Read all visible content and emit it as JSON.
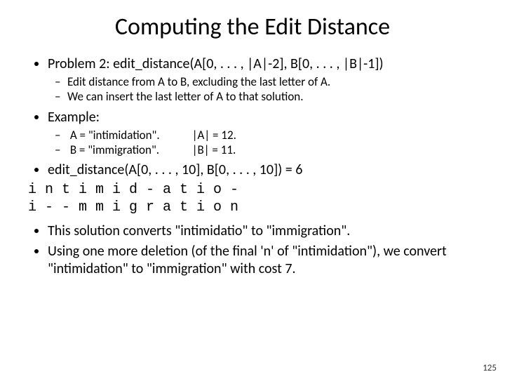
{
  "title": "Computing the Edit Distance",
  "b1": "Problem 2: edit_distance(A[0, . . . , |A|-2], B[0, . . . , |B|-1])",
  "b1s1": "Edit distance from A to B, excluding the last letter of A.",
  "b1s2": "We can insert the last letter of A to that solution.",
  "b2": "Example:",
  "b2s1a": "A = \"intimidation\".",
  "b2s1b": "|A| = 12.",
  "b2s2a": "B = \"immigration\".",
  "b2s2b": "|B| = 11.",
  "b3": "edit_distance(A[0, . . . , 10], B[0, . . . , 10]) = 6",
  "row1": "i n t i m i d - a t i o -",
  "row2": "i - - m m i g r a t i o n",
  "b4": "This solution converts \"intimidatio\" to \"immigration\".",
  "b5": "Using one more deletion (of the final 'n' of \"intimidation\"), we convert \"intimidation\" to \"immigration\" with cost 7.",
  "page": "125"
}
